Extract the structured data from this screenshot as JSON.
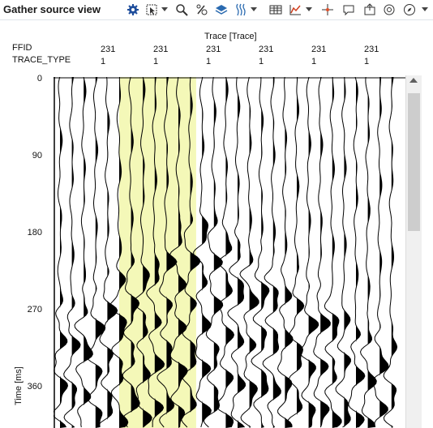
{
  "window": {
    "title": "Gather source view"
  },
  "toolbar": {
    "icons": [
      "settings-icon",
      "zoom-rect-icon",
      "zoom-icon",
      "probe-icon",
      "layers-icon",
      "wiggle-icon",
      "table-icon",
      "chart-icon",
      "crosshair-icon",
      "comment-icon",
      "export-icon",
      "screenshot-icon",
      "compass-icon"
    ]
  },
  "header": {
    "rows": [
      "FFID",
      "TRACE_TYPE"
    ],
    "ffid_values": [
      "231",
      "231",
      "231",
      "231",
      "231",
      "231"
    ],
    "trace_type_values": [
      "1",
      "1",
      "1",
      "1",
      "1",
      "1"
    ],
    "x_axis_title": "Trace [Trace]"
  },
  "y_axis": {
    "title": "Time [ms]",
    "ticks": [
      "0",
      "90",
      "180",
      "270",
      "360"
    ]
  },
  "chart_data": {
    "type": "seismic wiggle",
    "traces": 29,
    "y_range_ms": [
      0,
      400
    ],
    "highlight_color": "#f4f8b8",
    "wiggle_color": "#000000"
  }
}
